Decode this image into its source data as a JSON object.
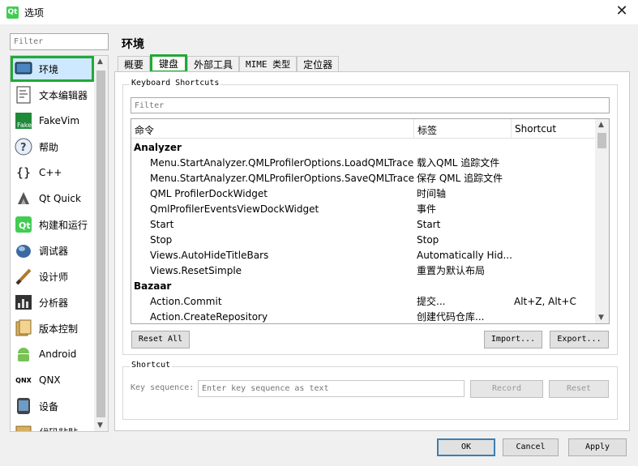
{
  "window": {
    "title": "选项",
    "app_icon": "Qt",
    "close_glyph": "✕"
  },
  "sidebar": {
    "filter_placeholder": "Filter",
    "items": [
      {
        "label": "环境",
        "icon": "monitor-icon"
      },
      {
        "label": "文本编辑器",
        "icon": "text-editor-icon"
      },
      {
        "label": "FakeVim",
        "icon": "fakevim-icon"
      },
      {
        "label": "帮助",
        "icon": "help-icon"
      },
      {
        "label": "C++",
        "icon": "cpp-braces-icon"
      },
      {
        "label": "Qt Quick",
        "icon": "qt-quick-icon"
      },
      {
        "label": "构建和运行",
        "icon": "build-run-icon"
      },
      {
        "label": "调试器",
        "icon": "debugger-icon"
      },
      {
        "label": "设计师",
        "icon": "designer-icon"
      },
      {
        "label": "分析器",
        "icon": "analyzer-icon"
      },
      {
        "label": "版本控制",
        "icon": "version-control-icon"
      },
      {
        "label": "Android",
        "icon": "android-icon"
      },
      {
        "label": "QNX",
        "icon": "qnx-icon"
      },
      {
        "label": "设备",
        "icon": "device-icon"
      },
      {
        "label": "代码粘贴",
        "icon": "code-paste-icon"
      }
    ]
  },
  "main": {
    "title": "环境",
    "tabs": [
      {
        "label": "概要"
      },
      {
        "label": "键盘"
      },
      {
        "label": "外部工具"
      },
      {
        "label": "MIME 类型"
      },
      {
        "label": "定位器"
      }
    ],
    "active_tab": 1
  },
  "shortcuts": {
    "group_title": "Keyboard Shortcuts",
    "filter_placeholder": "Filter",
    "columns": [
      "命令",
      "标签",
      "Shortcut"
    ],
    "rows": [
      {
        "type": "group",
        "command": "Analyzer",
        "label": "",
        "shortcut": ""
      },
      {
        "type": "item",
        "command": "Menu.StartAnalyzer.QMLProfilerOptions.LoadQMLTrace",
        "label": "载入QML 追踪文件",
        "shortcut": ""
      },
      {
        "type": "item",
        "command": "Menu.StartAnalyzer.QMLProfilerOptions.SaveQMLTrace",
        "label": "保存 QML 追踪文件",
        "shortcut": ""
      },
      {
        "type": "item",
        "command": "QML ProfilerDockWidget",
        "label": "时间轴",
        "shortcut": ""
      },
      {
        "type": "item",
        "command": "QmlProfilerEventsViewDockWidget",
        "label": "事件",
        "shortcut": ""
      },
      {
        "type": "item",
        "command": "Start",
        "label": "Start",
        "shortcut": ""
      },
      {
        "type": "item",
        "command": "Stop",
        "label": "Stop",
        "shortcut": ""
      },
      {
        "type": "item",
        "command": "Views.AutoHideTitleBars",
        "label": "Automatically Hid...",
        "shortcut": ""
      },
      {
        "type": "item",
        "command": "Views.ResetSimple",
        "label": "重置为默认布局",
        "shortcut": ""
      },
      {
        "type": "group",
        "command": "Bazaar",
        "label": "",
        "shortcut": ""
      },
      {
        "type": "item",
        "command": "Action.Commit",
        "label": "提交...",
        "shortcut": "Alt+Z, Alt+C"
      },
      {
        "type": "item",
        "command": "Action.CreateRepository",
        "label": "创建代码仓库...",
        "shortcut": ""
      }
    ],
    "reset_all": "Reset All",
    "import": "Import...",
    "export": "Export..."
  },
  "shortcut_editor": {
    "group_title": "Shortcut",
    "key_sequence_label": "Key sequence:",
    "key_sequence_placeholder": "Enter key sequence as text",
    "record": "Record",
    "reset": "Reset"
  },
  "footer": {
    "ok": "OK",
    "cancel": "Cancel",
    "apply": "Apply"
  },
  "colors": {
    "highlight": "#22a83a",
    "selection": "#cde8ff"
  }
}
